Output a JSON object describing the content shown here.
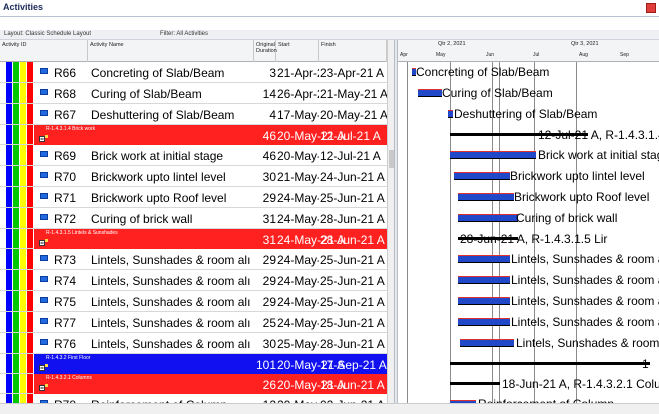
{
  "window": {
    "title": "Activities"
  },
  "toolbar": {
    "layout": "Layout: Classic Schedule Layout",
    "filter": "Filter: All Activities"
  },
  "columns": {
    "id": "Activity ID",
    "name": "Activity Name",
    "orig": "Original Duration",
    "start": "Start",
    "finish": "Finish"
  },
  "gantt_header": {
    "quarters": [
      "Qtr 2, 2021",
      "Qtr 3, 2021"
    ],
    "months": [
      "Apr",
      "May",
      "Jun",
      "Jul",
      "Aug",
      "Sep"
    ]
  },
  "rows": [
    {
      "type": "act",
      "id": "R66",
      "name": "Concreting of Slab/Beam",
      "dur": "3",
      "start": "21-Apr-21 A",
      "finish": "23-Apr-21 A",
      "gantt_label": "Concreting of Slab/Beam"
    },
    {
      "type": "act",
      "id": "R68",
      "name": "Curing of Slab/Beam",
      "dur": "14",
      "start": "26-Apr-21 A",
      "finish": "21-May-21 A",
      "gantt_label": "Curing of Slab/Beam"
    },
    {
      "type": "act",
      "id": "R67",
      "name": "Deshuttering of Slab/Beam",
      "dur": "4",
      "start": "17-May-21 A",
      "finish": "20-May-21 A",
      "gantt_label": "Deshuttering of Slab/Beam"
    },
    {
      "type": "wbs",
      "color": "#ff2020",
      "label": "R-1.4.3.1.4  Brick work",
      "dur": "46",
      "start": "20-May-21 A",
      "finish": "12-Jul-21 A",
      "gantt_label": "12-Jul-21 A, R-1.4.3.1.4"
    },
    {
      "type": "act",
      "id": "R69",
      "name": "Brick work at initial stage",
      "dur": "46",
      "start": "20-May-21 A",
      "finish": "12-Jul-21 A",
      "gantt_label": "Brick work at initial stag"
    },
    {
      "type": "act",
      "id": "R70",
      "name": "Brickwork upto lintel level",
      "dur": "30",
      "start": "21-May-21 A",
      "finish": "24-Jun-21 A",
      "gantt_label": "Brickwork upto lintel level"
    },
    {
      "type": "act",
      "id": "R71",
      "name": "Brickwork upto Roof level",
      "dur": "29",
      "start": "24-May-21 A",
      "finish": "25-Jun-21 A",
      "gantt_label": "Brickwork upto Roof level"
    },
    {
      "type": "act",
      "id": "R72",
      "name": "Curing of brick wall",
      "dur": "31",
      "start": "24-May-21 A",
      "finish": "28-Jun-21 A",
      "gantt_label": "Curing of brick wall"
    },
    {
      "type": "wbs",
      "color": "#ff2020",
      "label": "R-1.4.3.1.5  Lintels & Sunshades",
      "dur": "31",
      "start": "24-May-21 A",
      "finish": "28-Jun-21 A",
      "gantt_label": "28-Jun-21 A, R-1.4.3.1.5  Lir"
    },
    {
      "type": "act",
      "id": "R73",
      "name": "Lintels, Sunshades & room alı",
      "dur": "29",
      "start": "24-May-21 A",
      "finish": "25-Jun-21 A",
      "gantt_label": "Lintels, Sunshades & room a"
    },
    {
      "type": "act",
      "id": "R74",
      "name": "Lintels, Sunshades & room alı",
      "dur": "29",
      "start": "24-May-21 A",
      "finish": "25-Jun-21 A",
      "gantt_label": "Lintels, Sunshades & room a"
    },
    {
      "type": "act",
      "id": "R75",
      "name": "Lintels, Sunshades & room alı",
      "dur": "29",
      "start": "24-May-21 A",
      "finish": "25-Jun-21 A",
      "gantt_label": "Lintels, Sunshades & room a"
    },
    {
      "type": "act",
      "id": "R77",
      "name": "Lintels, Sunshades & room alı",
      "dur": "25",
      "start": "24-May-21 A",
      "finish": "25-Jun-21 A",
      "gantt_label": "Lintels, Sunshades & room a"
    },
    {
      "type": "act",
      "id": "R76",
      "name": "Lintels, Sunshades & room alı",
      "dur": "30",
      "start": "25-May-21 A",
      "finish": "28-Jun-21 A",
      "gantt_label": "Lintels, Sunshades & room"
    },
    {
      "type": "wbs",
      "color": "#1010f0",
      "label": "R-1.4.3.2  First Floor",
      "dur": "101",
      "start": "20-May-21 A",
      "finish": "17-Sep-21 A",
      "gantt_label": "1"
    },
    {
      "type": "wbs",
      "color": "#ff2020",
      "label": "R-1.4.3.2.1  Columns",
      "dur": "26",
      "start": "20-May-21 A",
      "finish": "18-Jun-21 A",
      "gantt_label": "18-Jun-21 A, R-1.4.3.2.1  Colun"
    },
    {
      "type": "act",
      "id": "R78",
      "name": "Reinforcement of Column",
      "dur": "12",
      "start": "20-May-21 A",
      "finish": "02-Jun-21 A",
      "gantt_label": "Reinforcement of Column"
    }
  ],
  "colors": {
    "wbs_red": "#ff2020",
    "wbs_blue": "#1010f0",
    "bar_blue": "#2048c8",
    "stripes": [
      "#0000ff",
      "#00c800",
      "#ffff00",
      "#ff0000"
    ]
  }
}
